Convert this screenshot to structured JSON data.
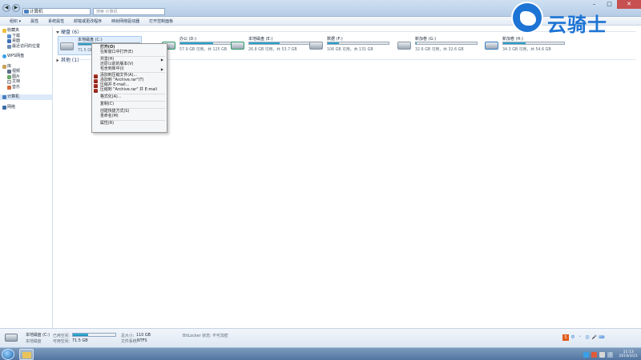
{
  "window": {
    "address_text": "计算机",
    "search_placeholder": "搜索 计算机"
  },
  "toolbar": {
    "items": [
      "组织 ▾",
      "属性",
      "系统属性",
      "卸载或更改程序",
      "映射网络驱动器",
      "打开控制面板"
    ]
  },
  "sidebar": {
    "favorites": {
      "header": "收藏夹",
      "items": [
        "下载",
        "桌面",
        "最近访问的位置"
      ]
    },
    "wps": "WPS网盘",
    "libraries": {
      "header": "库",
      "items": [
        "视频",
        "图片",
        "文档",
        "音乐"
      ]
    },
    "computer": "计算机",
    "network": "网络"
  },
  "main": {
    "hdd_group": "硬盘 (6)",
    "other_group": "其他 (1)",
    "drives": [
      {
        "name": "本地磁盘 (C:)",
        "free": "71.5 GB 可用，共 110 GB",
        "used_pct": 35
      },
      {
        "name": "办公 (D:)",
        "free": "57.9 GB 可用，共 125 GB",
        "used_pct": 54
      },
      {
        "name": "本地磁盘 (E:)",
        "free": "26.8 GB 可用，共 53.7 GB",
        "used_pct": 50
      },
      {
        "name": "数据 (F:)",
        "free": "106 GB 可用，共 131 GB",
        "used_pct": 19
      },
      {
        "name": "新加卷 (G:)",
        "free": "32.6 GB 可用，共 32.6 GB",
        "used_pct": 1
      },
      {
        "name": "新加卷 (H:)",
        "free": "34.3 GB 可用，共 54.6 GB",
        "used_pct": 37
      }
    ]
  },
  "context_menu": {
    "items": [
      {
        "label": "打开(O)",
        "bold": true
      },
      {
        "label": "在新窗口中打开(E)"
      },
      {
        "sep": true
      },
      {
        "label": "共享(H)",
        "arrow": true
      },
      {
        "label": "还原以前的版本(V)"
      },
      {
        "label": "包含到库中(I)",
        "arrow": true
      },
      {
        "sep": true
      },
      {
        "label": "添加到压缩文件(A)...",
        "rar": true
      },
      {
        "label": "添加到 \"Archive.rar\"(T)",
        "rar": true
      },
      {
        "label": "压缩并 E-mail...",
        "rar": true
      },
      {
        "label": "压缩到 \"Archive.rar\" 并 E-mail",
        "rar": true
      },
      {
        "sep": true
      },
      {
        "label": "格式化(A)..."
      },
      {
        "sep": true
      },
      {
        "label": "复制(C)"
      },
      {
        "sep": true
      },
      {
        "label": "创建快捷方式(S)"
      },
      {
        "label": "重命名(M)"
      },
      {
        "sep": true
      },
      {
        "label": "属性(R)"
      }
    ]
  },
  "details": {
    "name": "本地磁盘 (C:)",
    "type": "本地磁盘",
    "used_label": "已用空间:",
    "free_label": "可用空间:",
    "free_value": "71.5 GB",
    "total_label": "总大小:",
    "total_value": "110 GB",
    "fs_label": "文件系统:",
    "fs_value": "NTFS",
    "bitlocker": "BitLocker 状态: 不可加密",
    "used_pct": 35
  },
  "taskbar": {
    "time": "11:13",
    "date": "2019/3/21",
    "ime": [
      "S",
      "中",
      "⁺",
      "☺",
      "🎤",
      "⌨"
    ]
  },
  "watermark": {
    "text": "云骑士"
  },
  "colors": {
    "accent": "#1d74d4",
    "bar_fill": "#1b8fb8",
    "selection": "#e2eefc"
  }
}
